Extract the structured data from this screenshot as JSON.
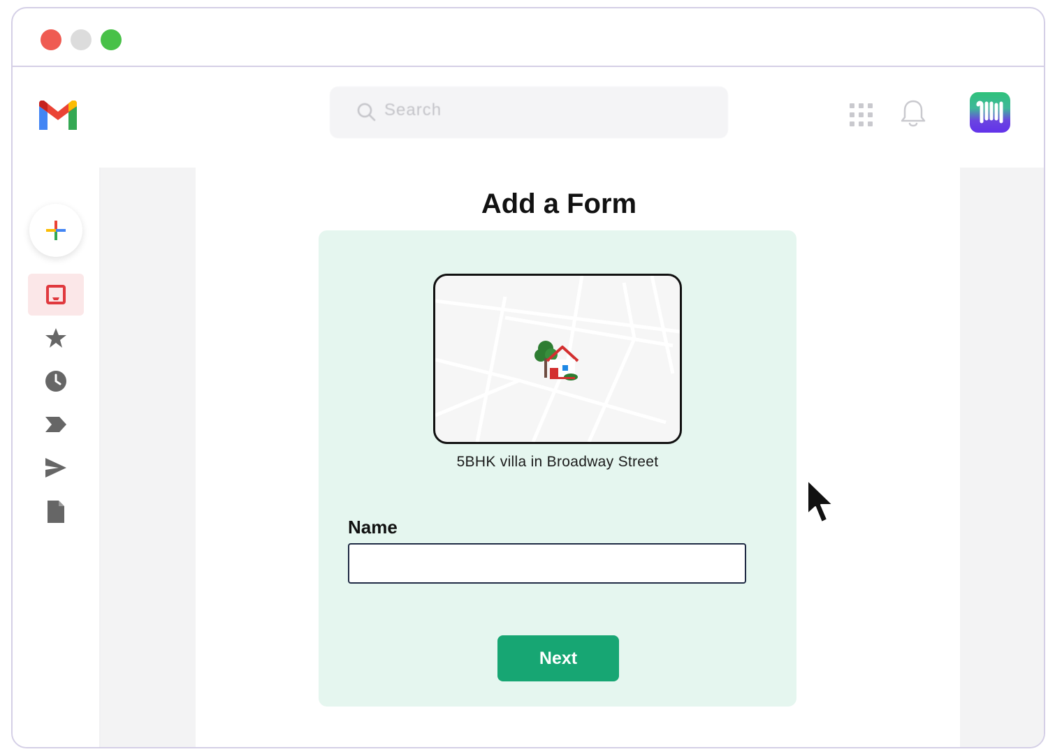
{
  "window_controls": [
    "close",
    "minimize",
    "maximize"
  ],
  "header": {
    "logo_icon": "gmail-logo",
    "search": {
      "placeholder": "Search",
      "icon": "search-icon"
    },
    "apps_icon": "apps-grid-icon",
    "notification_icon": "bell-icon",
    "account_icon": "brand-app-icon"
  },
  "sidebar": {
    "compose_icon": "plus-icon",
    "items": [
      {
        "icon": "inbox-icon",
        "active": true
      },
      {
        "icon": "star-icon",
        "active": false
      },
      {
        "icon": "clock-icon",
        "active": false
      },
      {
        "icon": "label-icon",
        "active": false
      },
      {
        "icon": "send-icon",
        "active": false
      },
      {
        "icon": "file-icon",
        "active": false
      }
    ]
  },
  "form": {
    "title": "Add a Form",
    "property_label": "5BHK villa in Broadway Street",
    "map_icon": "house-icon",
    "name_label": "Name",
    "name_value": "",
    "next_label": "Next"
  },
  "colors": {
    "card_bg": "#e5f6ef",
    "button": "#17a673",
    "active_item_bg": "#fbe7e8",
    "inbox_red": "#e0393e"
  }
}
